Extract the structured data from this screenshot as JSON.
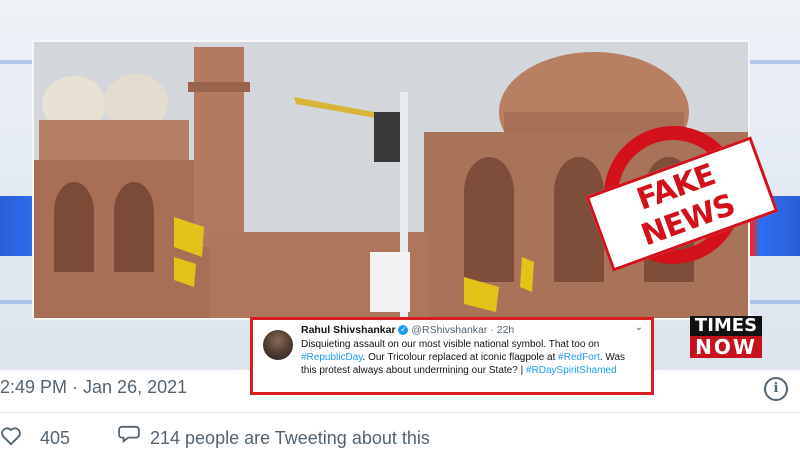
{
  "stamp": {
    "text": "FAKE NEWS",
    "color": "#d2111b"
  },
  "logo": {
    "line1": "TIMES",
    "line2": "NOW"
  },
  "tweet_card": {
    "name": "Rahul Shivshankar",
    "handle": "@RShivshankar",
    "time": "· 22h",
    "body_1": "Disquieting assault on our most visible national symbol. That too on ",
    "hashtag_1": "#RepublicDay",
    "body_2": ". Our Tricolour replaced at iconic flagpole at ",
    "hashtag_2": "#RedFort",
    "body_3": ". Was this protest always about undermining our State? | ",
    "hashtag_3": "#RDaySpiritShamed"
  },
  "post": {
    "timestamp": "2:49 PM · Jan 26, 2021",
    "likes": "405",
    "talking": "214 people are Tweeting about this"
  },
  "icons": {
    "verified": "verified-badge",
    "more": "chevron-down-icon",
    "info": "info-icon",
    "heart": "heart-icon",
    "comment": "comment-icon"
  }
}
